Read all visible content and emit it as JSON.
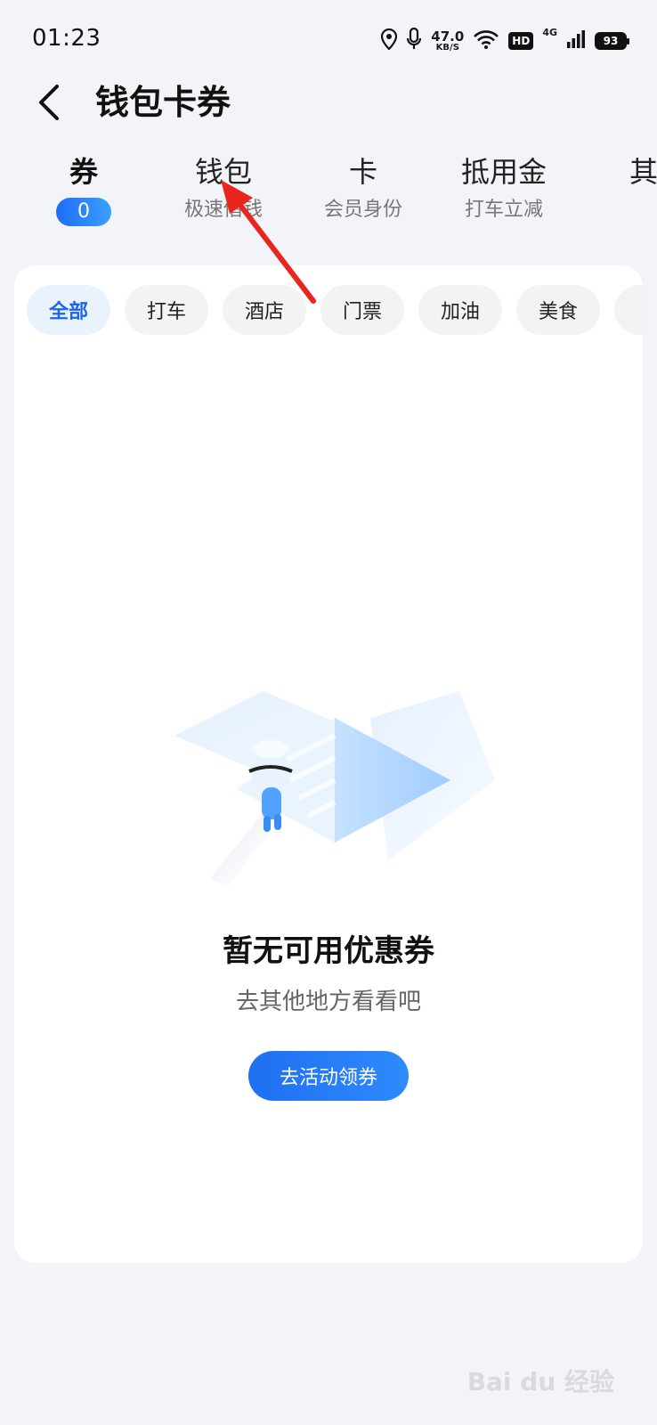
{
  "status_bar": {
    "time": "01:23",
    "speed_value": "47.0",
    "speed_unit": "KB/S",
    "hd": "HD",
    "network": "4G",
    "battery": "93"
  },
  "header": {
    "title": "钱包卡券"
  },
  "tabs": [
    {
      "label": "券",
      "badge": "0"
    },
    {
      "label": "钱包",
      "sub": "极速借钱"
    },
    {
      "label": "卡",
      "sub": "会员身份"
    },
    {
      "label": "抵用金",
      "sub": "打车立减"
    },
    {
      "label": "其",
      "sub": ""
    }
  ],
  "chips": [
    "全部",
    "打车",
    "酒店",
    "门票",
    "加油",
    "美食"
  ],
  "empty_state": {
    "title": "暂无可用优惠券",
    "subtitle": "去其他地方看看吧",
    "button_label": "去活动领券"
  },
  "watermark": "Bai du 经验",
  "colors": {
    "accent": "#1f6ff2",
    "annotation_arrow": "#e8261e"
  }
}
